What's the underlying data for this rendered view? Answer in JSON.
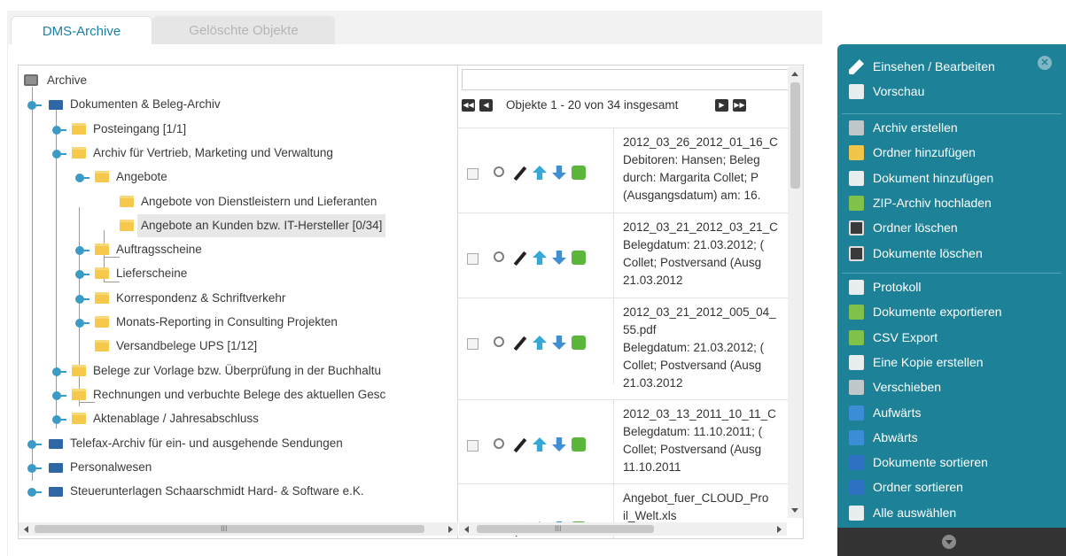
{
  "tabs": [
    {
      "label": "DMS-Archive",
      "active": true
    },
    {
      "label": "Gelöschte Objekte",
      "active": false
    }
  ],
  "tree": {
    "root": "Archive",
    "nodes": [
      {
        "label": "Dokumenten & Beleg-Archiv",
        "icon": "folder-blue-icon"
      },
      {
        "label": "Posteingang [1/1]",
        "icon": "folder-icon"
      },
      {
        "label": "Archiv für Vertrieb, Marketing und Verwaltung",
        "icon": "folder-icon"
      },
      {
        "label": "Angebote",
        "icon": "folder-icon"
      },
      {
        "label": "Angebote von Dienstleistern und Lieferanten",
        "icon": "folder-icon"
      },
      {
        "label": "Angebote an Kunden bzw. IT-Hersteller [0/34]",
        "icon": "folder-icon",
        "selected": true
      },
      {
        "label": "Auftragsscheine",
        "icon": "folder-icon"
      },
      {
        "label": "Lieferscheine",
        "icon": "folder-icon"
      },
      {
        "label": "Korrespondenz & Schriftverkehr",
        "icon": "folder-icon"
      },
      {
        "label": "Monats-Reporting in Consulting Projekten",
        "icon": "folder-icon"
      },
      {
        "label": "Versandbelege UPS [1/12]",
        "icon": "folder-icon"
      },
      {
        "label": "Belege zur Vorlage bzw. Überprüfung in der Buchhaltu",
        "icon": "folder-icon"
      },
      {
        "label": "Rechnungen und verbuchte Belege des aktuellen Gesc",
        "icon": "folder-icon"
      },
      {
        "label": "Aktenablage / Jahresabschluss",
        "icon": "folder-icon"
      },
      {
        "label": "Telefax-Archiv für ein- und ausgehende Sendungen",
        "icon": "folder-blue-icon"
      },
      {
        "label": "Personalwesen",
        "icon": "folder-blue-icon"
      },
      {
        "label": "Steuerunterlagen Schaarschmidt Hard- & Software e.K.",
        "icon": "folder-blue-icon"
      }
    ]
  },
  "pager": {
    "text": "Objekte 1 - 20 von 34 insgesamt",
    "first": "◀◀",
    "prev": "◀",
    "next": "▶",
    "last": "▶▶"
  },
  "documents": [
    {
      "lines": [
        "2012_03_26_2012_01_16_C",
        "Debitoren: Hansen; Beleg",
        "durch: Margarita Collet; P",
        "(Ausgangsdatum) am: 16."
      ]
    },
    {
      "lines": [
        "2012_03_21_2012_03_21_C",
        "Belegdatum: 21.03.2012; (",
        "Collet; Postversand (Ausg",
        "21.03.2012"
      ]
    },
    {
      "lines": [
        "2012_03_21_2012_005_04_",
        "55.pdf",
        "Belegdatum: 21.03.2012; (",
        "Collet; Postversand (Ausg",
        "21.03.2012"
      ]
    },
    {
      "lines": [
        "2012_03_13_2011_10_11_C",
        "Belegdatum: 11.10.2011; (",
        "Collet; Postversand (Ausg",
        "11.10.2011"
      ]
    },
    {
      "lines": [
        "Angebot_fuer_CLOUD_Pro",
        "il_Welt.xls"
      ]
    }
  ],
  "scroll": {
    "grip": "III"
  },
  "side_panel": {
    "close_label": "✕",
    "groups": [
      [
        {
          "label": "Einsehen / Bearbeiten",
          "icon": "pen-icon"
        },
        {
          "label": "Vorschau",
          "icon": "preview-icon"
        }
      ],
      [
        {
          "label": "Archiv erstellen",
          "icon": "archive-add-icon"
        },
        {
          "label": "Ordner hinzufügen",
          "icon": "folder-add-icon"
        },
        {
          "label": "Dokument hinzufügen",
          "icon": "document-add-icon"
        },
        {
          "label": "ZIP-Archiv hochladen",
          "icon": "zip-upload-icon"
        },
        {
          "label": "Ordner löschen",
          "icon": "trash-icon"
        },
        {
          "label": "Dokumente löschen",
          "icon": "trash-icon"
        }
      ],
      [
        {
          "label": "Protokoll",
          "icon": "log-icon"
        },
        {
          "label": "Dokumente exportieren",
          "icon": "export-icon"
        },
        {
          "label": "CSV Export",
          "icon": "csv-export-icon"
        },
        {
          "label": "Eine Kopie erstellen",
          "icon": "copy-icon"
        },
        {
          "label": "Verschieben",
          "icon": "move-icon"
        },
        {
          "label": "Aufwärts",
          "icon": "arrow-up-icon"
        },
        {
          "label": "Abwärts",
          "icon": "arrow-down-icon"
        },
        {
          "label": "Dokumente sortieren",
          "icon": "sort-icon"
        },
        {
          "label": "Ordner sortieren",
          "icon": "sort-icon"
        },
        {
          "label": "Alle auswählen",
          "icon": "select-all-icon"
        }
      ]
    ]
  }
}
